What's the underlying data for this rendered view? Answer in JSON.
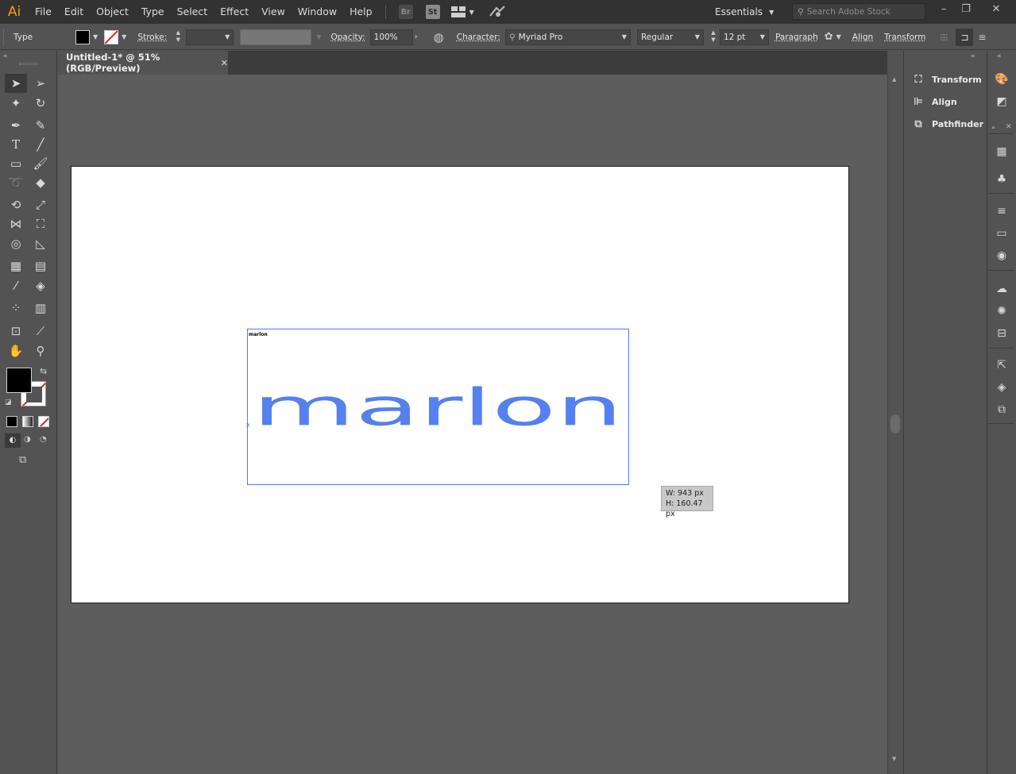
{
  "app": {
    "logo": "Ai"
  },
  "menu": [
    "File",
    "Edit",
    "Object",
    "Type",
    "Select",
    "Effect",
    "View",
    "Window",
    "Help"
  ],
  "menu_icons": {
    "bridge": "Br",
    "stock": "St"
  },
  "workspace": {
    "label": "Essentials"
  },
  "search": {
    "placeholder": "Search Adobe Stock"
  },
  "control_bar": {
    "tool_label": "Type",
    "stroke_label": "Stroke:",
    "opacity_label": "Opacity:",
    "opacity_value": "100%",
    "character_label": "Character:",
    "font_family": "Myriad Pro",
    "font_style": "Regular",
    "font_size": "12 pt",
    "paragraph_label": "Paragraph",
    "align_label": "Align",
    "transform_label": "Transform"
  },
  "document": {
    "tab_title": "Untitled-1* @ 51% (RGB/Preview)"
  },
  "artwork": {
    "small_text": "marlon",
    "large_text": "marlon",
    "text_color": "#5580f0"
  },
  "dimension_tooltip": {
    "width": "W: 943 px",
    "height": "H: 160.47 px"
  },
  "panels": [
    {
      "label": "Transform",
      "icon": "transform-icon"
    },
    {
      "label": "Align",
      "icon": "align-icon"
    },
    {
      "label": "Pathfinder",
      "icon": "pathfinder-icon"
    }
  ],
  "colors": {
    "menubar": "#323232",
    "ui": "#535353",
    "canvas": "#5d5d5d",
    "selection": "#4f78ff",
    "logo": "#ff9a00"
  }
}
